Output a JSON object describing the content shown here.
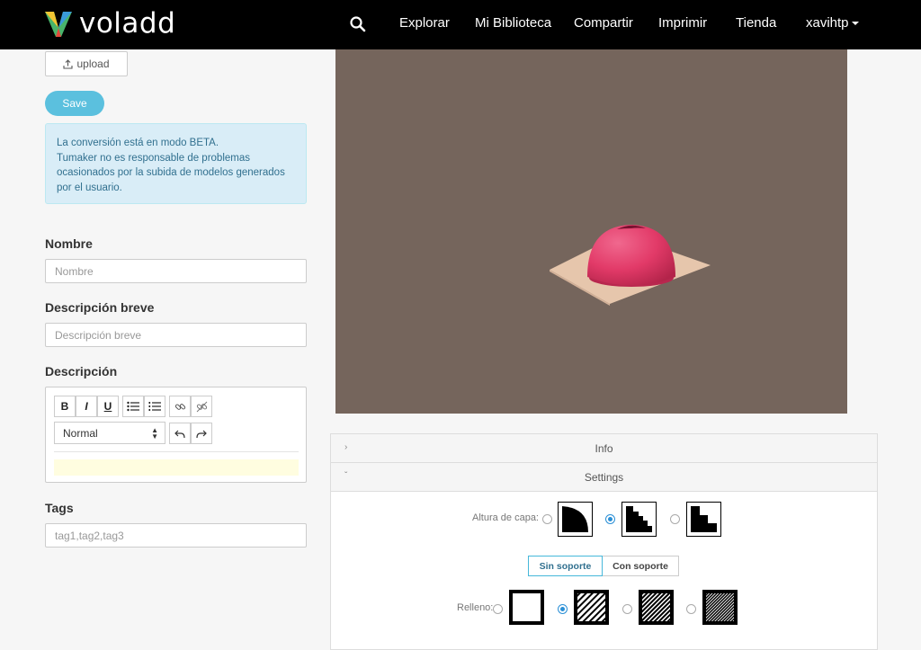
{
  "app": {
    "name": "voladd"
  },
  "nav": {
    "items": [
      "Explorar",
      "Mi Biblioteca",
      "Compartir",
      "Imprimir",
      "Tienda"
    ],
    "user": "xavihtp",
    "search_icon": "search-icon"
  },
  "form": {
    "upload_label": "upload",
    "save_label": "Save",
    "alert_lines": [
      "La conversión está en modo BETA.",
      "Tumaker no es responsable de problemas",
      "ocasionados por la subida de modelos generados",
      "por el usuario."
    ],
    "name_label": "Nombre",
    "name_placeholder": "Nombre",
    "short_desc_label": "Descripción breve",
    "short_desc_placeholder": "Descripción breve",
    "desc_label": "Descripción",
    "editor": {
      "bold": "B",
      "italic": "I",
      "underline": "U",
      "format_value": "Normal"
    },
    "tags_label": "Tags",
    "tags_placeholder": "tag1,tag2,tag3"
  },
  "panel": {
    "info_label": "Info",
    "settings_label": "Settings",
    "layer_height_label": "Altura de capa:",
    "layer_height_selected": 2,
    "support_options": [
      "Sin soporte",
      "Con soporte"
    ],
    "support_selected": "Sin soporte",
    "infill_label": "Relleno:",
    "infill_selected": 2
  },
  "colors": {
    "nav_bg": "#000000",
    "accent": "#5bc0de",
    "viewer_bg": "#75655c",
    "model": "#e23a68",
    "platform": "#e6c6ac"
  }
}
